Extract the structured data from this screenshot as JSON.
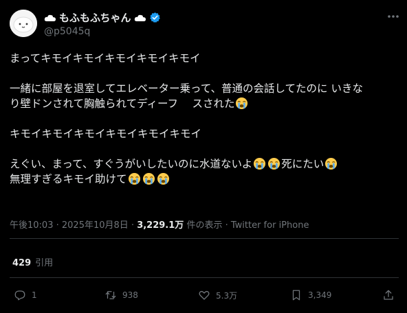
{
  "author": {
    "display_name": "もふもふちゃん",
    "handle": "@p5045q",
    "verified": true,
    "accent_color": "#1d9bf0"
  },
  "tweet": {
    "lines": [
      "まってキモイキモイキモイキモイキモイ",
      "一緒に部屋を退室してエレベーター乗って、普通の会話してたのに いきな",
      "り壁ドンされて胸触られてディーフ　 スされた",
      "キモイキモイキモイキモイキモイキモイ",
      "えぐい、まって、すぐうがいしたいのに水道ないよ",
      "死にたい",
      "無理すぎるキモイ助けて"
    ],
    "emoji": "loudly-crying-face"
  },
  "meta": {
    "time": "午後10:03",
    "date": "2025年10月8日",
    "views_count": "3,229.1万",
    "views_label": "件の表示",
    "source": "Twitter for iPhone"
  },
  "quotes": {
    "count": "429",
    "label": "引用"
  },
  "actions": {
    "reply_count": "1",
    "retweet_count": "938",
    "like_count": "5.3万",
    "bookmark_count": "3,349"
  }
}
